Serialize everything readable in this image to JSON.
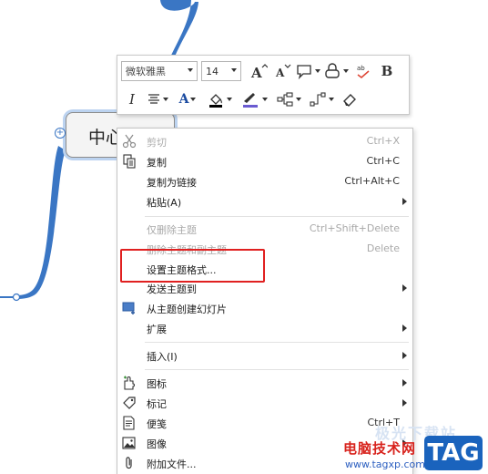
{
  "canvas": {
    "topic_text": "中心主题",
    "collapse_symbol": "+"
  },
  "toolbar": {
    "font_family": "微软雅黑",
    "font_size": "14",
    "bold_label": "B",
    "italic_label": "I",
    "font_color_label": "A",
    "font_color": "#1a1a1a",
    "fill_color": "#000000",
    "line_color": "#6a5bd1"
  },
  "menu": {
    "items": [
      {
        "label": "剪切",
        "shortcut": "Ctrl+X",
        "icon": "scissors-icon",
        "disabled": true
      },
      {
        "label": "复制",
        "shortcut": "Ctrl+C",
        "icon": "copy-icon",
        "disabled": false
      },
      {
        "label": "复制为链接",
        "shortcut": "Ctrl+Alt+C",
        "icon": "",
        "disabled": false
      },
      {
        "label": "粘贴(A)",
        "shortcut": "",
        "icon": "",
        "disabled": false,
        "submenu": true
      },
      {
        "label": "仅删除主题",
        "shortcut": "Ctrl+Shift+Delete",
        "icon": "",
        "disabled": true
      },
      {
        "label": "删除主题和副主题",
        "shortcut": "Delete",
        "icon": "",
        "disabled": true
      },
      {
        "label": "设置主题格式...",
        "shortcut": "",
        "icon": "",
        "disabled": false
      },
      {
        "label": "发送主题到",
        "shortcut": "",
        "icon": "",
        "disabled": false,
        "submenu": true
      },
      {
        "label": "从主题创建幻灯片",
        "shortcut": "",
        "icon": "slide-icon",
        "disabled": false
      },
      {
        "label": "扩展",
        "shortcut": "",
        "icon": "",
        "disabled": false,
        "submenu": true
      },
      {
        "label": "插入(I)",
        "shortcut": "",
        "icon": "",
        "disabled": false,
        "submenu": true
      },
      {
        "label": "图标",
        "shortcut": "",
        "icon": "puzzle-icon",
        "disabled": false,
        "submenu": true
      },
      {
        "label": "标记",
        "shortcut": "",
        "icon": "tag-icon",
        "disabled": false,
        "submenu": true
      },
      {
        "label": "便笺",
        "shortcut": "Ctrl+T",
        "icon": "note-icon",
        "disabled": false
      },
      {
        "label": "图像",
        "shortcut": "",
        "icon": "image-icon",
        "disabled": false,
        "submenu": true
      },
      {
        "label": "附加文件...",
        "shortcut": "",
        "icon": "paperclip-icon",
        "disabled": false
      }
    ],
    "highlight_color": "#e02020"
  },
  "watermark": {
    "site_name": "电脑技术网",
    "slogan": "极光下载站",
    "url": "www.tagxp.com",
    "badge": "TAG"
  },
  "colors": {
    "branch": "#3a76c4",
    "accent_red": "#d8231d",
    "badge_blue": "#1a63bd"
  }
}
